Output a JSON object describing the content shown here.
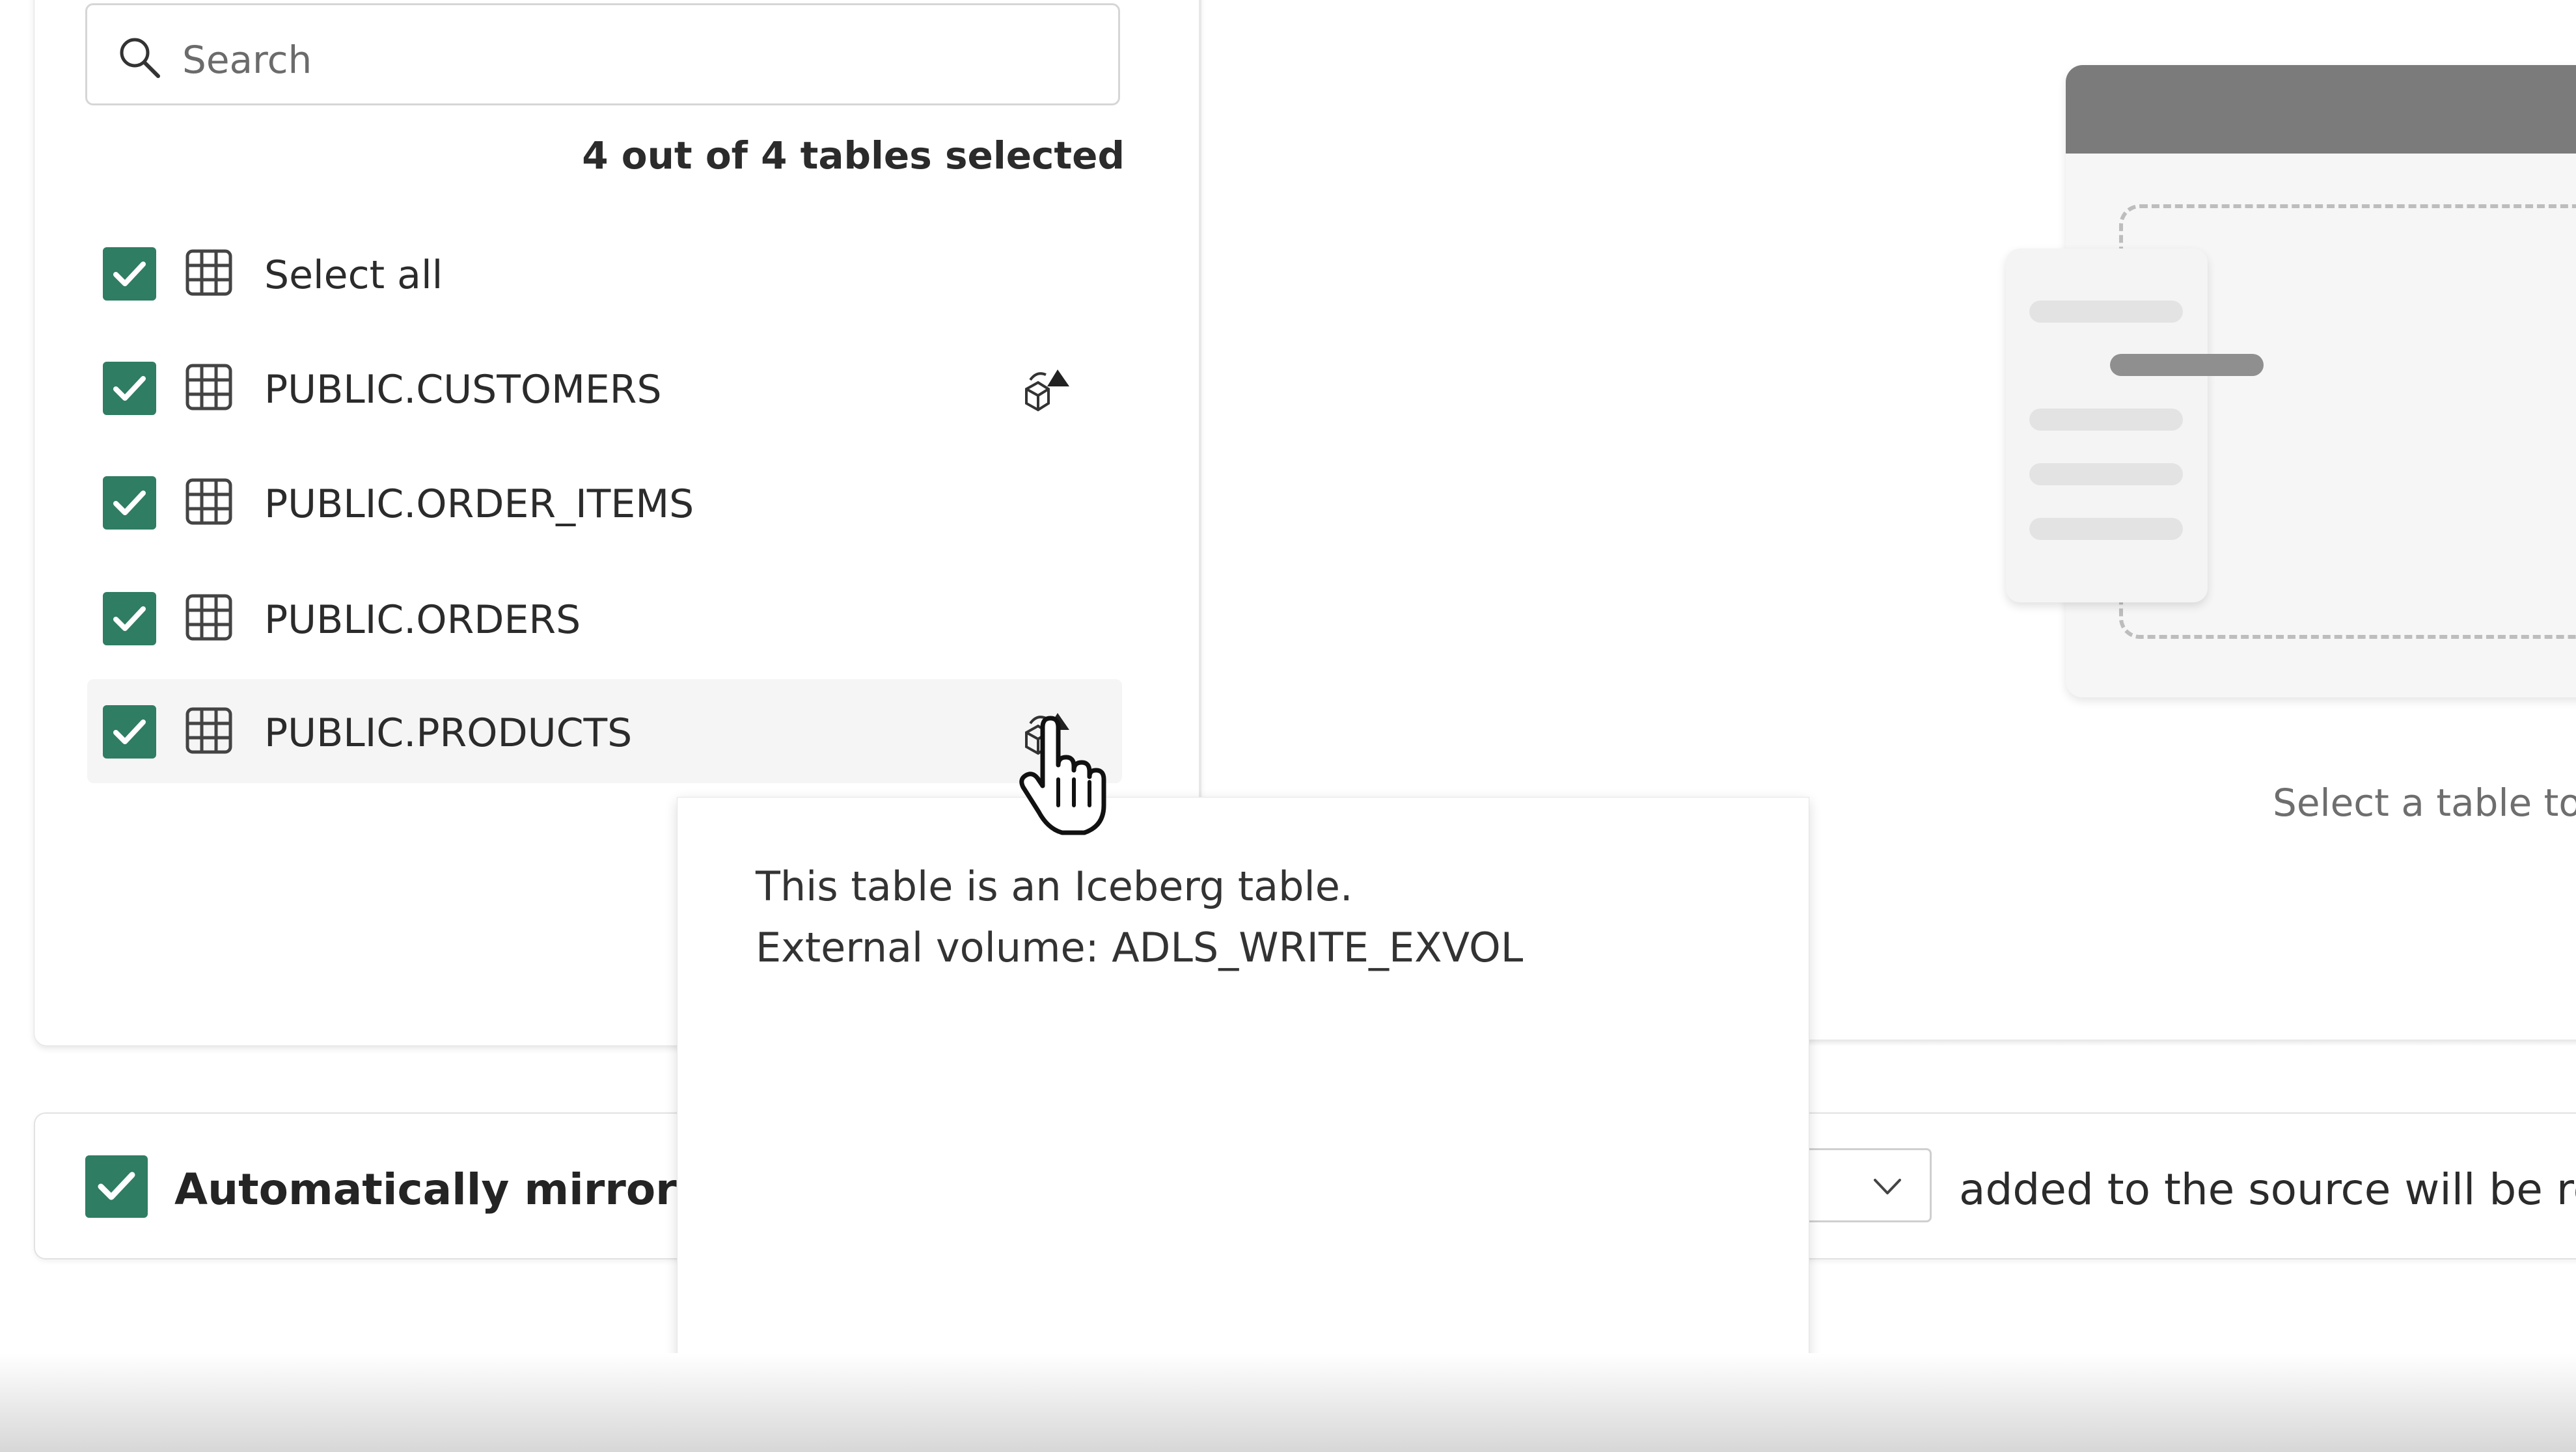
{
  "search": {
    "placeholder": "Search"
  },
  "selection_summary": "4 out of 4 tables selected",
  "tables": [
    {
      "label": "Select all",
      "checked": true,
      "iceberg": false
    },
    {
      "label": "PUBLIC.CUSTOMERS",
      "checked": true,
      "iceberg": true
    },
    {
      "label": "PUBLIC.ORDER_ITEMS",
      "checked": true,
      "iceberg": false
    },
    {
      "label": "PUBLIC.ORDERS",
      "checked": true,
      "iceberg": false
    },
    {
      "label": "PUBLIC.PRODUCTS",
      "checked": true,
      "iceberg": true,
      "hovered": true
    }
  ],
  "tooltip": {
    "line1": "This table is an Iceberg table.",
    "line2": "External volume: ADLS_WRITE_EXVOL"
  },
  "mirror": {
    "checked": true,
    "label": "Automatically mirror futu",
    "after_text": "added to the source will be rep"
  },
  "preview": {
    "hint": "Select a table to"
  },
  "colors": {
    "accent": "#2f7d62"
  }
}
